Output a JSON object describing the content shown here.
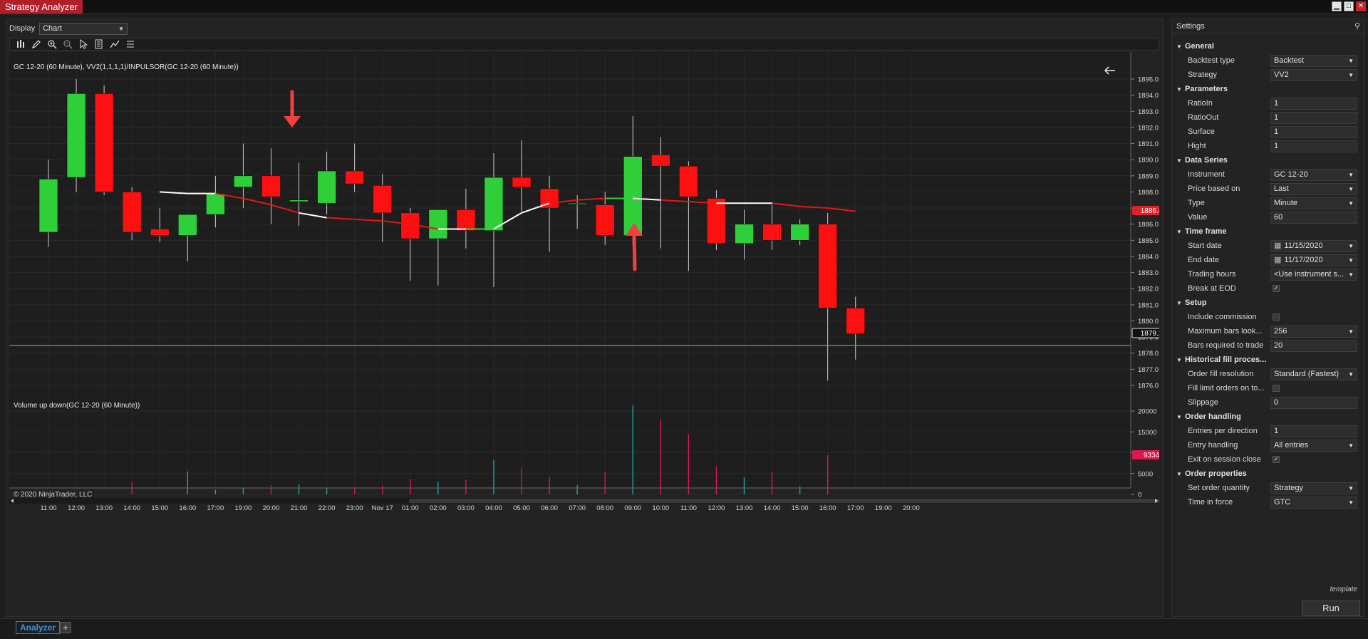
{
  "window": {
    "title": "Strategy Analyzer",
    "minimize": "▁",
    "maximize": "□",
    "close": "✕"
  },
  "display": {
    "label": "Display",
    "value": "Chart"
  },
  "chart": {
    "price_title": "GC 12-20 (60 Minute), VV2(1,1,1,1)/INPULSOR(GC 12-20 (60 Minute))",
    "volume_title": "Volume up down(GC 12-20 (60 Minute))",
    "copyright": "© 2020 NinjaTrader, LLC",
    "last_price_label": "1886.8",
    "cursor_price_label": "1879.2",
    "last_volume_label": "9334",
    "colors": {
      "up": "#2fcf3a",
      "down": "#ff1010",
      "vol_up": "#1aa6a6",
      "vol_down": "#e0174f",
      "background": "#1e1e1e"
    }
  },
  "chart_data": {
    "type": "candlestick",
    "price_axis": {
      "min": 1876.0,
      "max": 1895.0,
      "ticks": [
        "1895.0",
        "1894.0",
        "1893.0",
        "1892.0",
        "1891.0",
        "1890.0",
        "1889.0",
        "1888.0",
        "1887.0",
        "1886.0",
        "1885.0",
        "1884.0",
        "1883.0",
        "1882.0",
        "1881.0",
        "1880.0",
        "1879.0",
        "1878.0",
        "1877.0",
        "1876.0"
      ]
    },
    "volume_axis": {
      "min": 0,
      "max": 20000,
      "ticks": [
        "20000",
        "15000",
        "10000",
        "5000",
        "0"
      ]
    },
    "x_labels": [
      "11:00",
      "12:00",
      "13:00",
      "14:00",
      "15:00",
      "16:00",
      "17:00",
      "19:00",
      "20:00",
      "21:00",
      "22:00",
      "23:00",
      "Nov 17",
      "01:00",
      "02:00",
      "03:00",
      "04:00",
      "05:00",
      "06:00",
      "07:00",
      "08:00",
      "09:00",
      "10:00",
      "11:00",
      "12:00",
      "13:00",
      "14:00",
      "15:00",
      "16:00",
      "17:00",
      "19:00",
      "20:00"
    ],
    "candles": [
      {
        "o": 1885.5,
        "h": 1890.0,
        "l": 1884.6,
        "c": 1888.8
      },
      {
        "o": 1888.9,
        "h": 1895.0,
        "l": 1888.0,
        "c": 1894.1
      },
      {
        "o": 1894.1,
        "h": 1894.6,
        "l": 1887.8,
        "c": 1888.0
      },
      {
        "o": 1888.0,
        "h": 1888.3,
        "l": 1885.0,
        "c": 1885.5
      },
      {
        "o": 1885.7,
        "h": 1887.0,
        "l": 1884.9,
        "c": 1885.3
      },
      {
        "o": 1885.3,
        "h": 1886.6,
        "l": 1883.7,
        "c": 1886.6
      },
      {
        "o": 1886.6,
        "h": 1889.0,
        "l": 1885.8,
        "c": 1887.9
      },
      {
        "o": 1888.3,
        "h": 1891.0,
        "l": 1887.0,
        "c": 1889.0
      },
      {
        "o": 1889.0,
        "h": 1890.7,
        "l": 1886.0,
        "c": 1887.7
      },
      {
        "o": 1887.4,
        "h": 1889.8,
        "l": 1885.9,
        "c": 1887.5
      },
      {
        "o": 1887.3,
        "h": 1890.5,
        "l": 1886.6,
        "c": 1889.3
      },
      {
        "o": 1889.3,
        "h": 1891.0,
        "l": 1888.0,
        "c": 1888.5
      },
      {
        "o": 1888.4,
        "h": 1889.1,
        "l": 1884.9,
        "c": 1886.7
      },
      {
        "o": 1886.7,
        "h": 1887.0,
        "l": 1882.5,
        "c": 1885.1
      },
      {
        "o": 1885.1,
        "h": 1886.9,
        "l": 1882.2,
        "c": 1886.9
      },
      {
        "o": 1886.9,
        "h": 1888.2,
        "l": 1884.5,
        "c": 1885.6
      },
      {
        "o": 1885.6,
        "h": 1890.4,
        "l": 1882.1,
        "c": 1888.9
      },
      {
        "o": 1888.9,
        "h": 1891.2,
        "l": 1886.8,
        "c": 1888.3
      },
      {
        "o": 1888.2,
        "h": 1889.0,
        "l": 1884.3,
        "c": 1887.0
      },
      {
        "o": 1887.3,
        "h": 1887.8,
        "l": 1885.7,
        "c": 1887.3
      },
      {
        "o": 1887.2,
        "h": 1888.0,
        "l": 1884.7,
        "c": 1885.3
      },
      {
        "o": 1885.3,
        "h": 1892.7,
        "l": 1884.7,
        "c": 1890.2
      },
      {
        "o": 1890.3,
        "h": 1891.4,
        "l": 1884.5,
        "c": 1889.6
      },
      {
        "o": 1889.6,
        "h": 1889.9,
        "l": 1883.1,
        "c": 1887.7
      },
      {
        "o": 1887.6,
        "h": 1888.1,
        "l": 1884.4,
        "c": 1884.8
      },
      {
        "o": 1884.8,
        "h": 1886.9,
        "l": 1883.8,
        "c": 1886.0
      },
      {
        "o": 1886.0,
        "h": 1887.2,
        "l": 1884.4,
        "c": 1885.0
      },
      {
        "o": 1885.0,
        "h": 1886.3,
        "l": 1884.7,
        "c": 1886.0
      },
      {
        "o": 1886.0,
        "h": 1886.7,
        "l": 1876.3,
        "c": 1880.8
      },
      {
        "o": 1880.8,
        "h": 1881.5,
        "l": 1877.6,
        "c": 1879.2
      }
    ],
    "indicator_line": {
      "start_index": 4,
      "points": [
        {
          "v": 1888.0,
          "color": "white"
        },
        {
          "v": 1887.9,
          "color": "white"
        },
        {
          "v": 1887.9,
          "color": "white"
        },
        {
          "v": 1887.6,
          "color": "red"
        },
        {
          "v": 1887.2,
          "color": "red"
        },
        {
          "v": 1886.7,
          "color": "red"
        },
        {
          "v": 1886.4,
          "color": "white"
        },
        {
          "v": 1886.3,
          "color": "red"
        },
        {
          "v": 1886.2,
          "color": "red"
        },
        {
          "v": 1886.0,
          "color": "red"
        },
        {
          "v": 1885.7,
          "color": "red"
        },
        {
          "v": 1885.7,
          "color": "white"
        },
        {
          "v": 1885.7,
          "color": "green"
        },
        {
          "v": 1886.7,
          "color": "white"
        },
        {
          "v": 1887.3,
          "color": "white"
        },
        {
          "v": 1887.5,
          "color": "red"
        },
        {
          "v": 1887.6,
          "color": "red"
        },
        {
          "v": 1887.6,
          "color": "green"
        },
        {
          "v": 1887.5,
          "color": "white"
        },
        {
          "v": 1887.4,
          "color": "red"
        },
        {
          "v": 1887.3,
          "color": "red"
        },
        {
          "v": 1887.3,
          "color": "white"
        },
        {
          "v": 1887.3,
          "color": "white"
        },
        {
          "v": 1887.1,
          "color": "red"
        },
        {
          "v": 1887.0,
          "color": "red"
        },
        {
          "v": 1886.8,
          "color": "red"
        }
      ]
    },
    "volume": [
      0,
      0,
      0,
      3000,
      0,
      5500,
      1100,
      1600,
      2200,
      2400,
      1500,
      1700,
      2100,
      3600,
      3000,
      3500,
      8300,
      6200,
      4200,
      2200,
      5300,
      21400,
      18000,
      14500,
      6700,
      4100,
      5400,
      1900,
      9334,
      0
    ]
  },
  "settings": {
    "title": "Settings",
    "sections": [
      {
        "name": "General",
        "props": [
          {
            "label": "Backtest type",
            "value": "Backtest",
            "kind": "dropdown"
          },
          {
            "label": "Strategy",
            "value": "VV2",
            "kind": "dropdown"
          }
        ]
      },
      {
        "name": "Parameters",
        "props": [
          {
            "label": "RatioIn",
            "value": "1",
            "kind": "text"
          },
          {
            "label": "RatioOut",
            "value": "1",
            "kind": "text"
          },
          {
            "label": "Surface",
            "value": "1",
            "kind": "text"
          },
          {
            "label": "Hight",
            "value": "1",
            "kind": "text"
          }
        ]
      },
      {
        "name": "Data Series",
        "props": [
          {
            "label": "Instrument",
            "value": "GC 12-20",
            "kind": "dropdown"
          },
          {
            "label": "Price based on",
            "value": "Last",
            "kind": "dropdown"
          },
          {
            "label": "Type",
            "value": "Minute",
            "kind": "dropdown"
          },
          {
            "label": "Value",
            "value": "60",
            "kind": "text"
          }
        ]
      },
      {
        "name": "Time frame",
        "props": [
          {
            "label": "Start date",
            "value": "11/15/2020",
            "kind": "date"
          },
          {
            "label": "End date",
            "value": "11/17/2020",
            "kind": "date"
          },
          {
            "label": "Trading hours",
            "value": "<Use instrument s...",
            "kind": "dropdown"
          },
          {
            "label": "Break at EOD",
            "value": "✓",
            "kind": "check"
          }
        ]
      },
      {
        "name": "Setup",
        "props": [
          {
            "label": "Include commission",
            "value": "",
            "kind": "check"
          },
          {
            "label": "Maximum bars look...",
            "value": "256",
            "kind": "dropdown"
          },
          {
            "label": "Bars required to trade",
            "value": "20",
            "kind": "text"
          }
        ]
      },
      {
        "name": "Historical fill proces...",
        "props": [
          {
            "label": "Order fill resolution",
            "value": "Standard (Fastest)",
            "kind": "dropdown"
          },
          {
            "label": "Fill limit orders on to...",
            "value": "",
            "kind": "check"
          },
          {
            "label": "Slippage",
            "value": "0",
            "kind": "text"
          }
        ]
      },
      {
        "name": "Order handling",
        "props": [
          {
            "label": "Entries per direction",
            "value": "1",
            "kind": "text"
          },
          {
            "label": "Entry handling",
            "value": "All entries",
            "kind": "dropdown"
          },
          {
            "label": "Exit on session close",
            "value": "✓",
            "kind": "check"
          }
        ]
      },
      {
        "name": "Order properties",
        "props": [
          {
            "label": "Set order quantity",
            "value": "Strategy",
            "kind": "dropdown"
          },
          {
            "label": "Time in force",
            "value": "GTC",
            "kind": "dropdown"
          }
        ]
      }
    ],
    "template_label": "template",
    "run_label": "Run"
  },
  "bottom": {
    "tab_label": "Analyzer",
    "add_label": "+"
  }
}
